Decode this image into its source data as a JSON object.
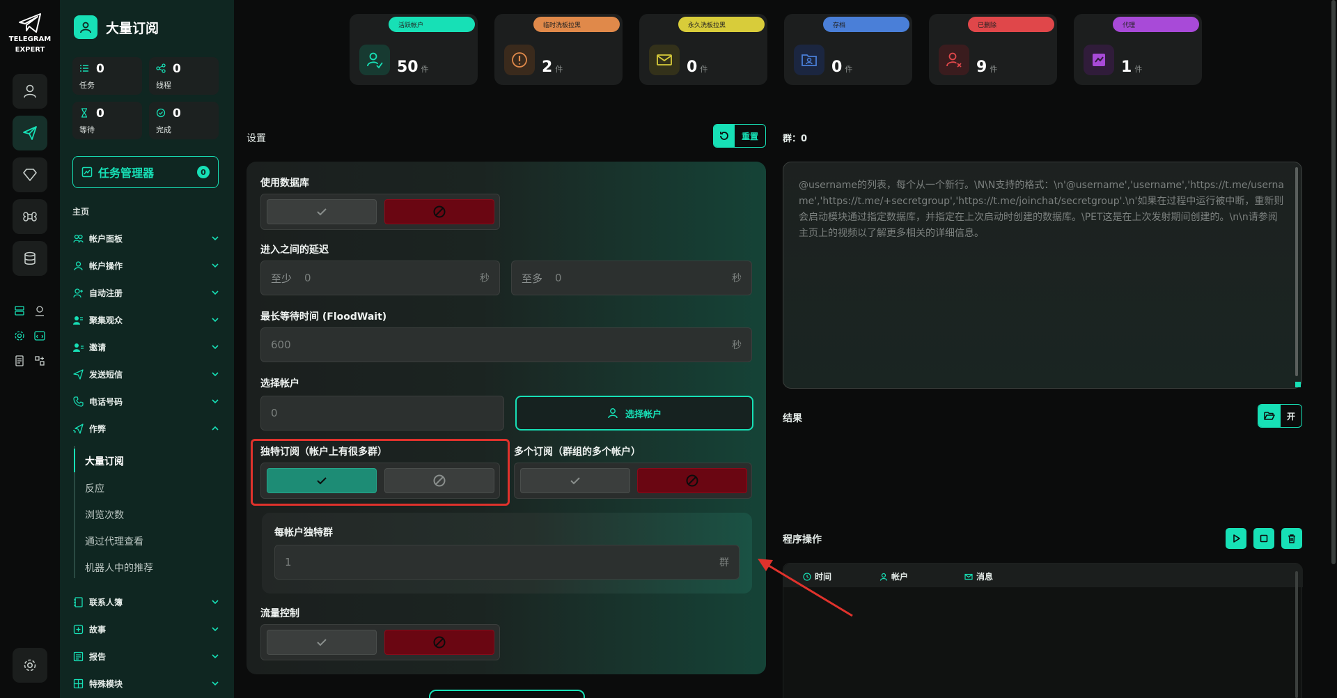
{
  "app": {
    "logo_line1": "TELEGRAM",
    "logo_line2": "EXPERT"
  },
  "sidebar": {
    "title": "大量订阅",
    "stats": [
      {
        "value": "0",
        "label": "任务"
      },
      {
        "value": "0",
        "label": "线程"
      },
      {
        "value": "0",
        "label": "等待"
      },
      {
        "value": "0",
        "label": "完成"
      }
    ],
    "task_manager": {
      "label": "任务管理器",
      "badge": "0"
    },
    "section": "主页",
    "items": [
      {
        "label": "帐户面板"
      },
      {
        "label": "帐户操作"
      },
      {
        "label": "自动注册"
      },
      {
        "label": "聚集观众"
      },
      {
        "label": "邀请"
      },
      {
        "label": "发送短信"
      },
      {
        "label": "电话号码"
      },
      {
        "label": "作弊"
      }
    ],
    "sub_items": [
      {
        "label": "大量订阅"
      },
      {
        "label": "反应"
      },
      {
        "label": "浏览次数"
      },
      {
        "label": "通过代理查看"
      },
      {
        "label": "机器人中的推荐"
      }
    ],
    "items_after": [
      {
        "label": "联系人簿"
      },
      {
        "label": "故事"
      },
      {
        "label": "报告"
      },
      {
        "label": "特殊模块"
      }
    ]
  },
  "top_cards": [
    {
      "tag": "活跃帐户",
      "value": "50",
      "unit": "件",
      "color": "#17e0b6",
      "icon": "user-icon"
    },
    {
      "tag": "临时洗板拉黑",
      "value": "2",
      "unit": "件",
      "color": "#e0894a",
      "icon": "warning-icon"
    },
    {
      "tag": "永久洗板拉黑",
      "value": "0",
      "unit": "件",
      "color": "#d8cc3a",
      "icon": "mail-icon"
    },
    {
      "tag": "存档",
      "value": "0",
      "unit": "件",
      "color": "#4a7fd8",
      "icon": "folder-user-icon"
    },
    {
      "tag": "已删除",
      "value": "9",
      "unit": "件",
      "color": "#e0474a",
      "icon": "user-remove-icon"
    },
    {
      "tag": "代理",
      "value": "1",
      "unit": "件",
      "color": "#a84ad8",
      "icon": "proxy-icon"
    }
  ],
  "settings": {
    "title": "设置",
    "reset_label": "重置",
    "use_db_label": "使用数据库",
    "delay_label": "进入之间的延迟",
    "delay_min_prefix": "至少",
    "delay_min_value": "0",
    "delay_max_prefix": "至多",
    "delay_max_value": "0",
    "unit_sec": "秒",
    "floodwait_label": "最长等待时间 (FloodWait)",
    "floodwait_value": "600",
    "select_account_label": "选择帐户",
    "select_account_value": "0",
    "select_account_button": "选择帐户",
    "unique_sub_label": "独特订阅（帐户上有很多群）",
    "multi_sub_label": "多个订阅（群组的多个帐户）",
    "unique_per_account_label": "每帐户独特群",
    "unique_per_account_value": "1",
    "unique_per_account_unit": "群",
    "flow_control_label": "流量控制"
  },
  "right": {
    "groups_label": "群：0",
    "textarea_placeholder": "@username的列表，每个从一个新行。\\N\\N支持的格式：\\n'@username','username','https://t.me/username','https://t.me/+secretgroup','https://t.me/joinchat/secretgroup'.\\n'如果在过程中运行被中断，重新则会启动模块通过指定数据库，并指定在上次启动时创建的数据库。\\PET这是在上次发射期间创建的。\\n\\n请参阅主页上的视频以了解更多相关的详细信息。",
    "result_label": "结果",
    "open_label": "开",
    "ops_label": "程序操作",
    "log_headers": [
      {
        "label": "时间"
      },
      {
        "label": "帐户"
      },
      {
        "label": "消息"
      }
    ]
  }
}
